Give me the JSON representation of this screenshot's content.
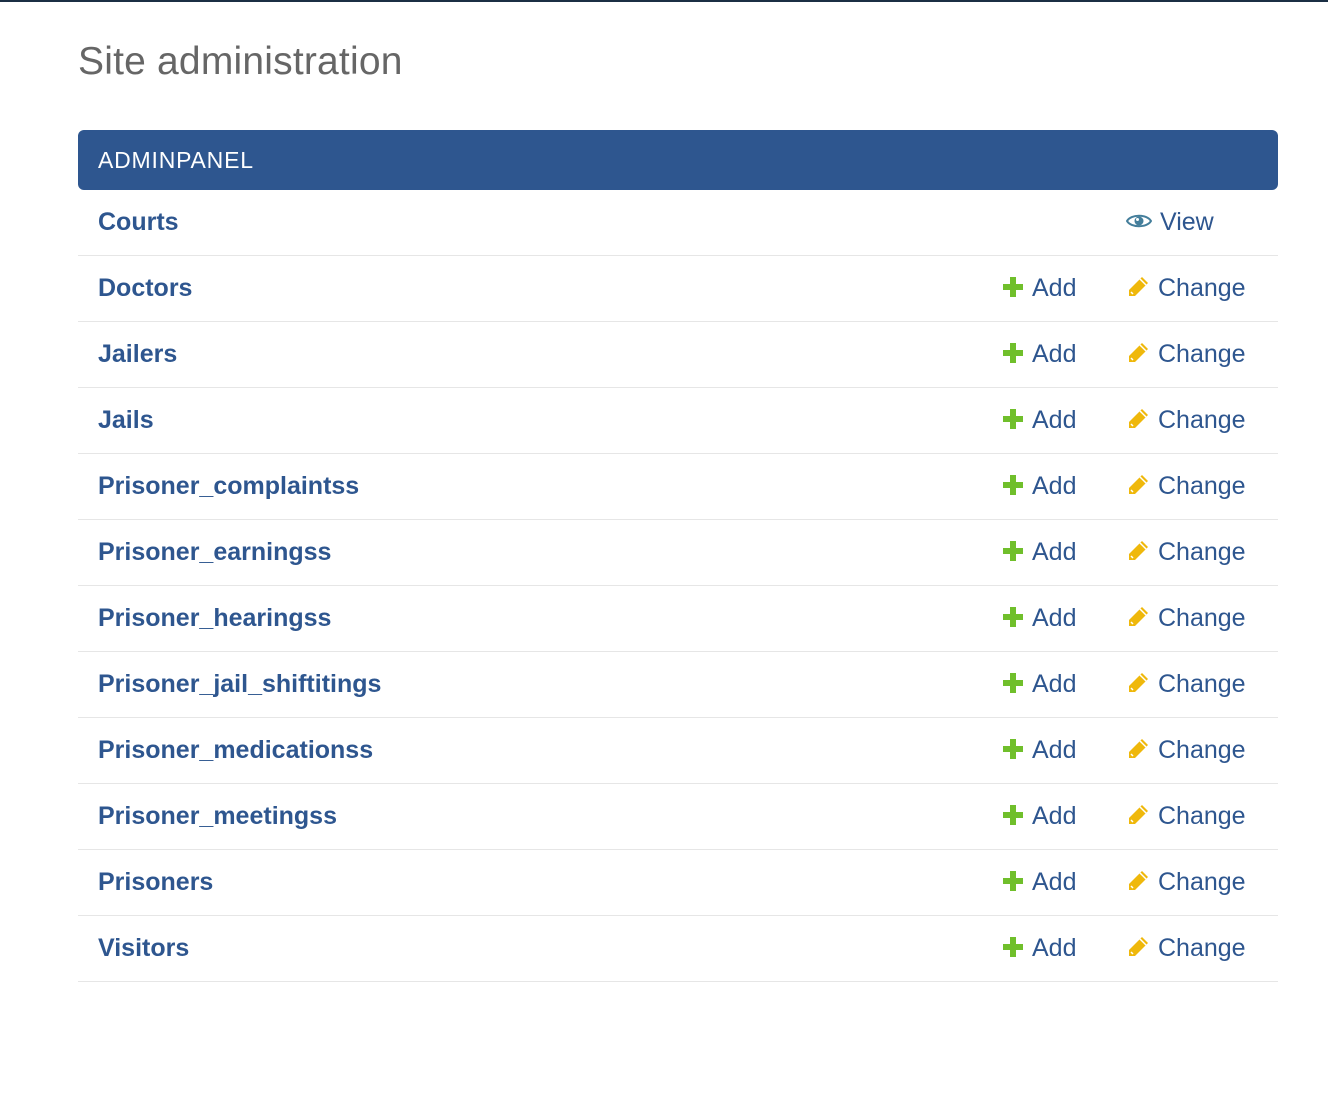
{
  "page": {
    "title": "Site administration"
  },
  "module": {
    "caption": "ADMINPANEL",
    "rows": [
      {
        "name": "Courts",
        "view_label": "View"
      },
      {
        "name": "Doctors",
        "add_label": "Add",
        "change_label": "Change"
      },
      {
        "name": "Jailers",
        "add_label": "Add",
        "change_label": "Change"
      },
      {
        "name": "Jails",
        "add_label": "Add",
        "change_label": "Change"
      },
      {
        "name": "Prisoner_complaintss",
        "add_label": "Add",
        "change_label": "Change"
      },
      {
        "name": "Prisoner_earningss",
        "add_label": "Add",
        "change_label": "Change"
      },
      {
        "name": "Prisoner_hearingss",
        "add_label": "Add",
        "change_label": "Change"
      },
      {
        "name": "Prisoner_jail_shiftitings",
        "add_label": "Add",
        "change_label": "Change"
      },
      {
        "name": "Prisoner_medicationss",
        "add_label": "Add",
        "change_label": "Change"
      },
      {
        "name": "Prisoner_meetingss",
        "add_label": "Add",
        "change_label": "Change"
      },
      {
        "name": "Prisoners",
        "add_label": "Add",
        "change_label": "Change"
      },
      {
        "name": "Visitors",
        "add_label": "Add",
        "change_label": "Change"
      }
    ]
  },
  "icons": {
    "view": "eye-icon",
    "add": "plus-icon",
    "change": "pencil-icon"
  },
  "colors": {
    "link": "#2e568f",
    "caption_bg": "#2e568f",
    "add_icon": "#70bf2b",
    "change_icon": "#efb80b"
  }
}
